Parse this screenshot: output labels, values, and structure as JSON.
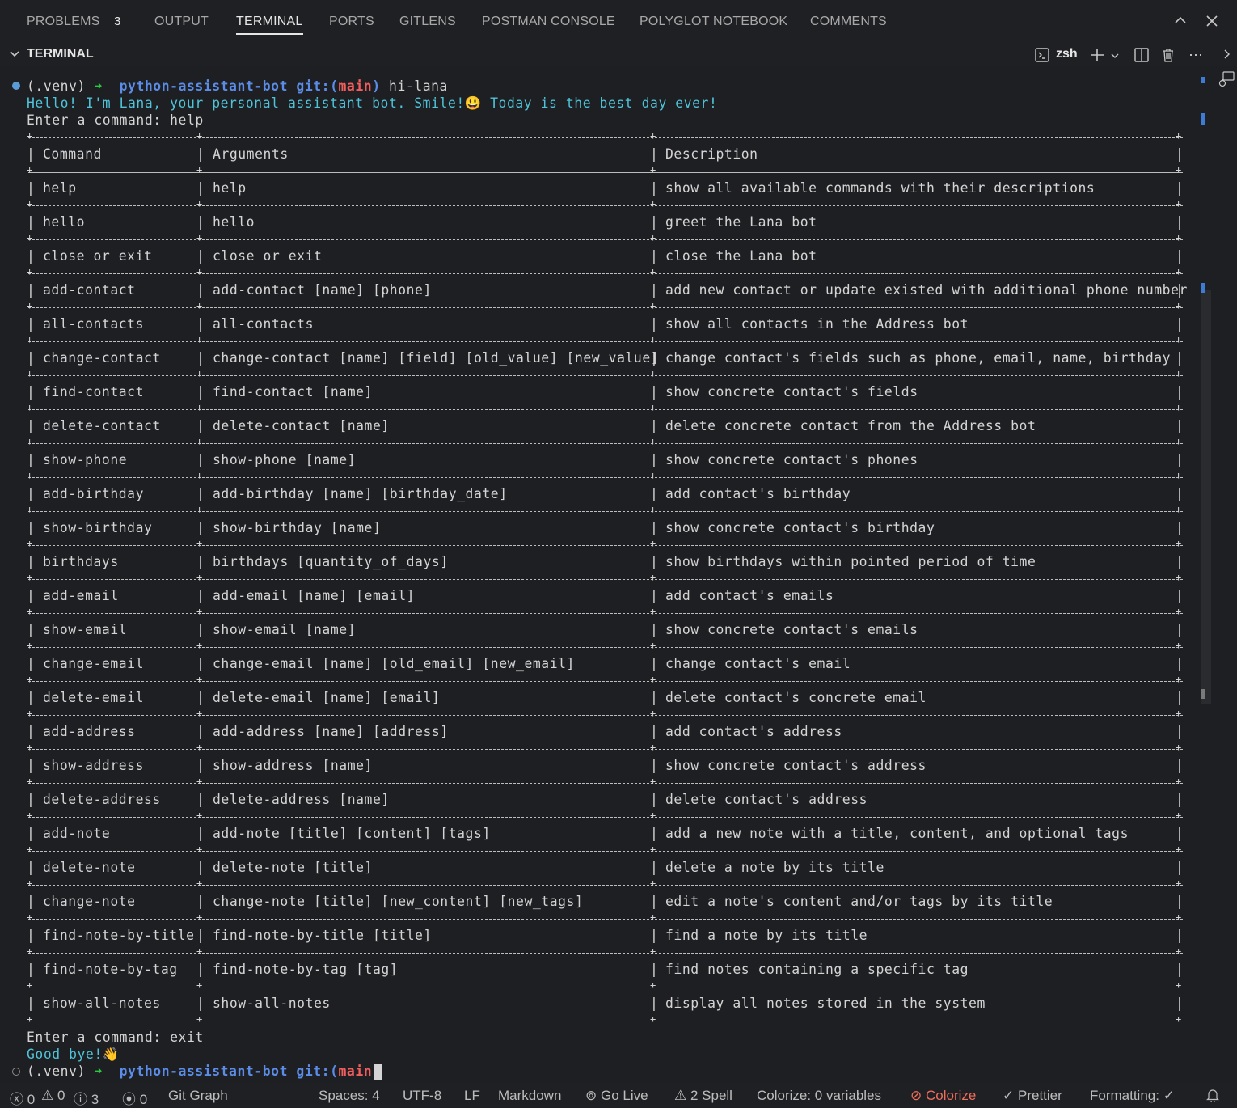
{
  "tabs": [
    {
      "label": "PROBLEMS",
      "badge": "3"
    },
    {
      "label": "OUTPUT"
    },
    {
      "label": "TERMINAL",
      "active": true
    },
    {
      "label": "PORTS"
    },
    {
      "label": "GITLENS"
    },
    {
      "label": "POSTMAN CONSOLE"
    },
    {
      "label": "POLYGLOT NOTEBOOK"
    },
    {
      "label": "COMMENTS"
    }
  ],
  "terminal_header": {
    "title": "TERMINAL",
    "shell": "zsh"
  },
  "prompt": {
    "venv": "(.venv)",
    "arrow": "➜",
    "dir": "python-assistant-bot",
    "git": "git:(",
    "branch": "main",
    "git_close": ")",
    "command": "hi-lana"
  },
  "greeting": "Hello! I'm Lana, your personal assistant bot. Smile!😃 Today is the best day ever!",
  "enter_help": "Enter a command: help",
  "table": {
    "headers": [
      "Command",
      "Arguments",
      "Description"
    ],
    "rows": [
      [
        "help",
        "help",
        "show all available commands with their descriptions"
      ],
      [
        "hello",
        "hello",
        "greet the Lana bot"
      ],
      [
        "close or exit",
        "close or exit",
        "close the Lana bot"
      ],
      [
        "add-contact",
        "add-contact [name] [phone]",
        "add new contact or update existed with additional phone number"
      ],
      [
        "all-contacts",
        "all-contacts",
        "show all contacts in the Address bot"
      ],
      [
        "change-contact",
        "change-contact [name] [field] [old_value] [new_value]",
        "change contact's fields such as phone, email, name, birthday"
      ],
      [
        "find-contact",
        "find-contact [name]",
        "show concrete contact's fields"
      ],
      [
        "delete-contact",
        "delete-contact [name]",
        "delete concrete contact from the Address bot"
      ],
      [
        "show-phone",
        "show-phone [name]",
        "show concrete contact's phones"
      ],
      [
        "add-birthday",
        "add-birthday [name] [birthday_date]",
        "add contact's birthday"
      ],
      [
        "show-birthday",
        "show-birthday [name]",
        "show concrete contact's birthday"
      ],
      [
        "birthdays",
        "birthdays [quantity_of_days]",
        "show birthdays within pointed period of time"
      ],
      [
        "add-email",
        "add-email [name] [email]",
        "add contact's emails"
      ],
      [
        "show-email",
        "show-email [name]",
        "show concrete contact's emails"
      ],
      [
        "change-email",
        "change-email [name] [old_email] [new_email]",
        "change contact's email"
      ],
      [
        "delete-email",
        "delete-email [name] [email]",
        "delete contact's concrete email"
      ],
      [
        "add-address",
        "add-address [name] [address]",
        "add contact's address"
      ],
      [
        "show-address",
        "show-address [name]",
        "show concrete contact's address"
      ],
      [
        "delete-address",
        "delete-address [name]",
        "delete contact's address"
      ],
      [
        "add-note",
        "add-note [title] [content] [tags]",
        "add a new note with a title, content, and optional tags"
      ],
      [
        "delete-note",
        "delete-note [title]",
        "delete a note by its title"
      ],
      [
        "change-note",
        "change-note [title] [new_content] [new_tags]",
        "edit a note's content and/or tags by its title"
      ],
      [
        "find-note-by-title",
        "find-note-by-title [title]",
        "find a note by its title"
      ],
      [
        "find-note-by-tag",
        "find-note-by-tag [tag]",
        "find notes containing a specific tag"
      ],
      [
        "show-all-notes",
        "show-all-notes",
        "display all notes stored in the system"
      ]
    ]
  },
  "enter_exit": "Enter a command: exit",
  "goodbye": "Good bye!👋",
  "statusbar": {
    "errors": "0",
    "warnings": "0",
    "info": "3",
    "ports": "0",
    "git_graph": "Git Graph",
    "spaces": "Spaces: 4",
    "encoding": "UTF-8",
    "eol": "LF",
    "language": "Markdown",
    "go_live": "Go Live",
    "spell": "2 Spell",
    "colorize_vars": "Colorize: 0 variables",
    "colorize": "Colorize",
    "prettier": "Prettier",
    "formatting": "Formatting: ✓"
  },
  "colors": {
    "accent": "#4fc3d9",
    "prompt_dir": "#5b8de8",
    "branch": "#f25d5d",
    "arrow": "#27c93f",
    "colorize": "#f06c5b"
  }
}
